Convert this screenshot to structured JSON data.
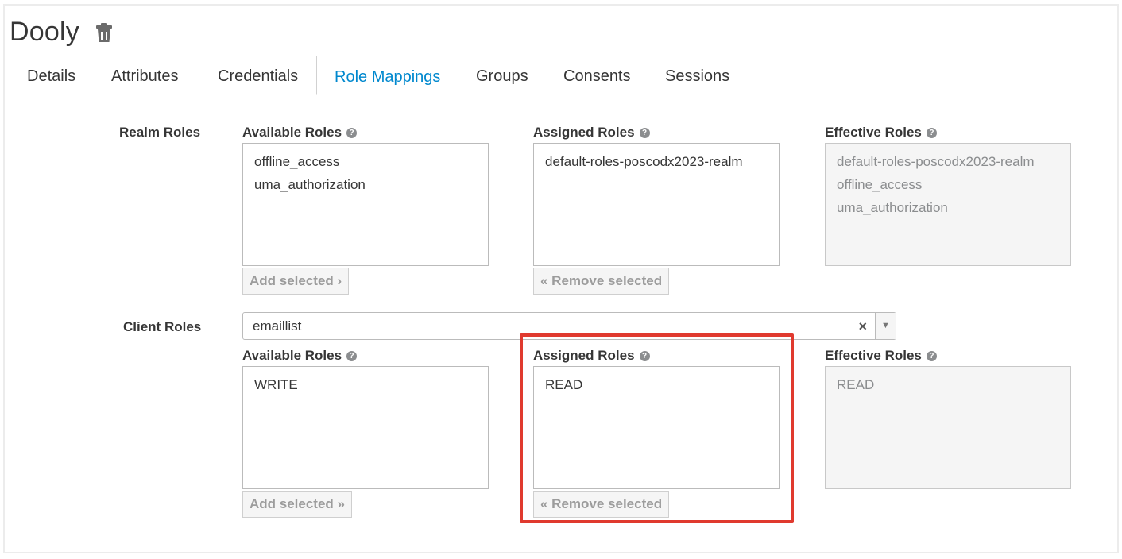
{
  "header": {
    "title": "Dooly",
    "delete_icon": "trash-icon"
  },
  "tabs": [
    {
      "label": "Details",
      "active": false
    },
    {
      "label": "Attributes",
      "active": false
    },
    {
      "label": "Credentials",
      "active": false
    },
    {
      "label": "Role Mappings",
      "active": true
    },
    {
      "label": "Groups",
      "active": false
    },
    {
      "label": "Consents",
      "active": false
    },
    {
      "label": "Sessions",
      "active": false
    }
  ],
  "realm_roles": {
    "label": "Realm Roles",
    "available": {
      "heading": "Available Roles",
      "items": [
        "offline_access",
        "uma_authorization"
      ],
      "button": "Add selected ›"
    },
    "assigned": {
      "heading": "Assigned Roles",
      "items": [
        "default-roles-poscodx2023-realm"
      ],
      "button": "« Remove selected"
    },
    "effective": {
      "heading": "Effective Roles",
      "items": [
        "default-roles-poscodx2023-realm",
        "offline_access",
        "uma_authorization"
      ]
    }
  },
  "client_roles": {
    "label": "Client Roles",
    "client_select": {
      "value": "emaillist",
      "clear": "×",
      "arrow": "▼"
    },
    "available": {
      "heading": "Available Roles",
      "items": [
        "WRITE"
      ],
      "button": "Add selected »"
    },
    "assigned": {
      "heading": "Assigned Roles",
      "items": [
        "READ"
      ],
      "button": "« Remove selected"
    },
    "effective": {
      "heading": "Effective Roles",
      "items": [
        "READ"
      ]
    }
  },
  "help_glyph": "?",
  "colors": {
    "accent": "#0088ce",
    "highlight": "#e03a2f"
  }
}
